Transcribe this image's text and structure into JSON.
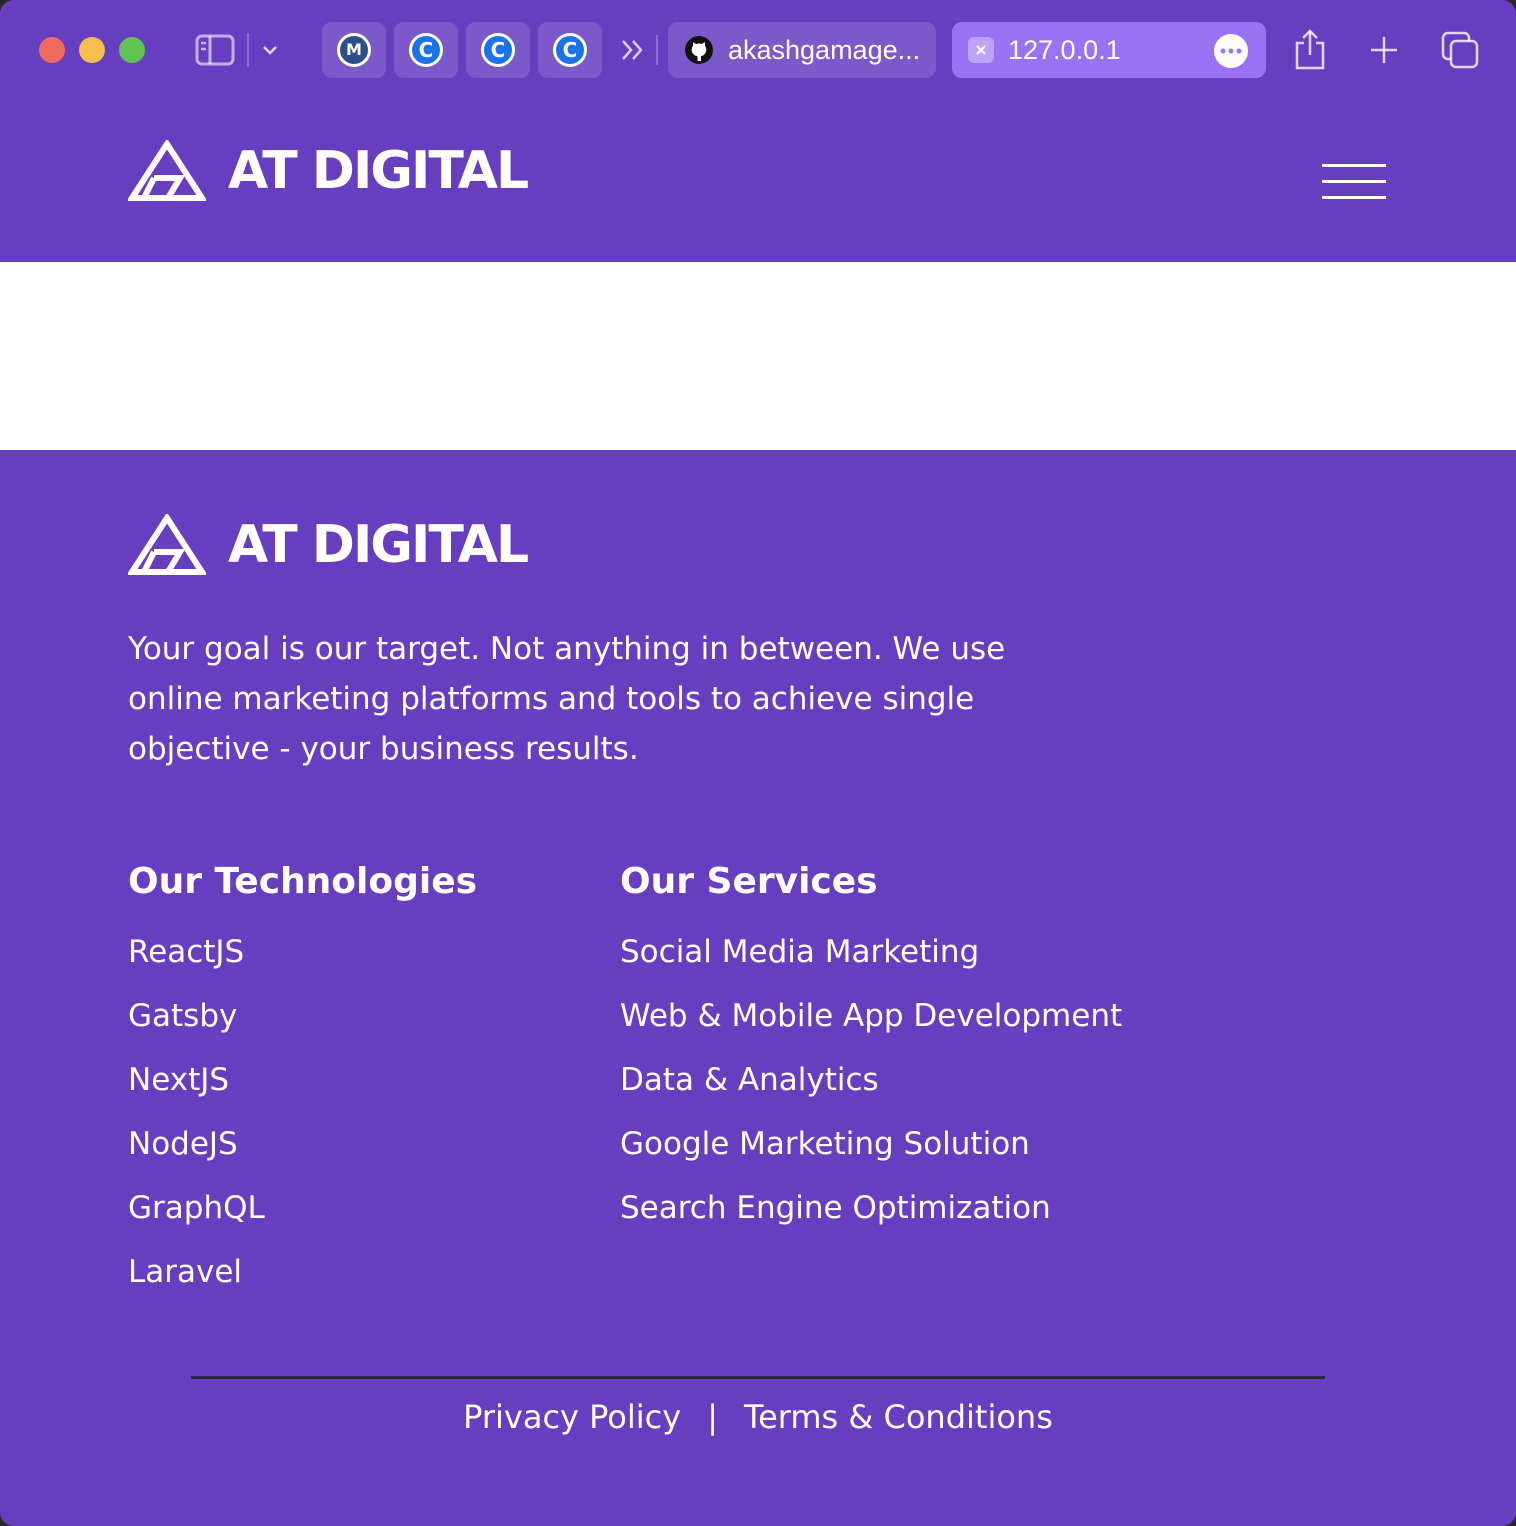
{
  "browser": {
    "pinned_tabs": [
      {
        "icon": "maps-icon",
        "glyph": "M"
      },
      {
        "icon": "c-site-icon",
        "glyph": "C"
      },
      {
        "icon": "c-site-icon",
        "glyph": "C"
      },
      {
        "icon": "c-site-icon",
        "glyph": "C"
      }
    ],
    "tabs": [
      {
        "title": "akashgamage...",
        "icon": "github-icon",
        "active": false
      },
      {
        "title": "127.0.0.1",
        "icon": "close-icon",
        "active": true
      }
    ]
  },
  "header": {
    "logo_text": "AT DIGITAL"
  },
  "footer": {
    "logo_text": "AT DIGITAL",
    "tagline": "Your goal is our target. Not anything in between. We use online marketing platforms and tools to achieve single objective - your business results.",
    "technologies": {
      "heading": "Our Technologies",
      "items": [
        "ReactJS",
        "Gatsby",
        "NextJS",
        "NodeJS",
        "GraphQL",
        "Laravel"
      ]
    },
    "services": {
      "heading": "Our Services",
      "items": [
        "Social Media Marketing",
        "Web & Mobile App Development",
        "Data & Analytics",
        "Google Marketing Solution",
        "Search Engine Optimization"
      ]
    },
    "legal": {
      "privacy": "Privacy Policy",
      "separator": "|",
      "terms": "Terms & Conditions"
    }
  },
  "colors": {
    "brand_purple": "#673ec0",
    "active_tab": "#9a73f5",
    "text": "#ffffff"
  }
}
